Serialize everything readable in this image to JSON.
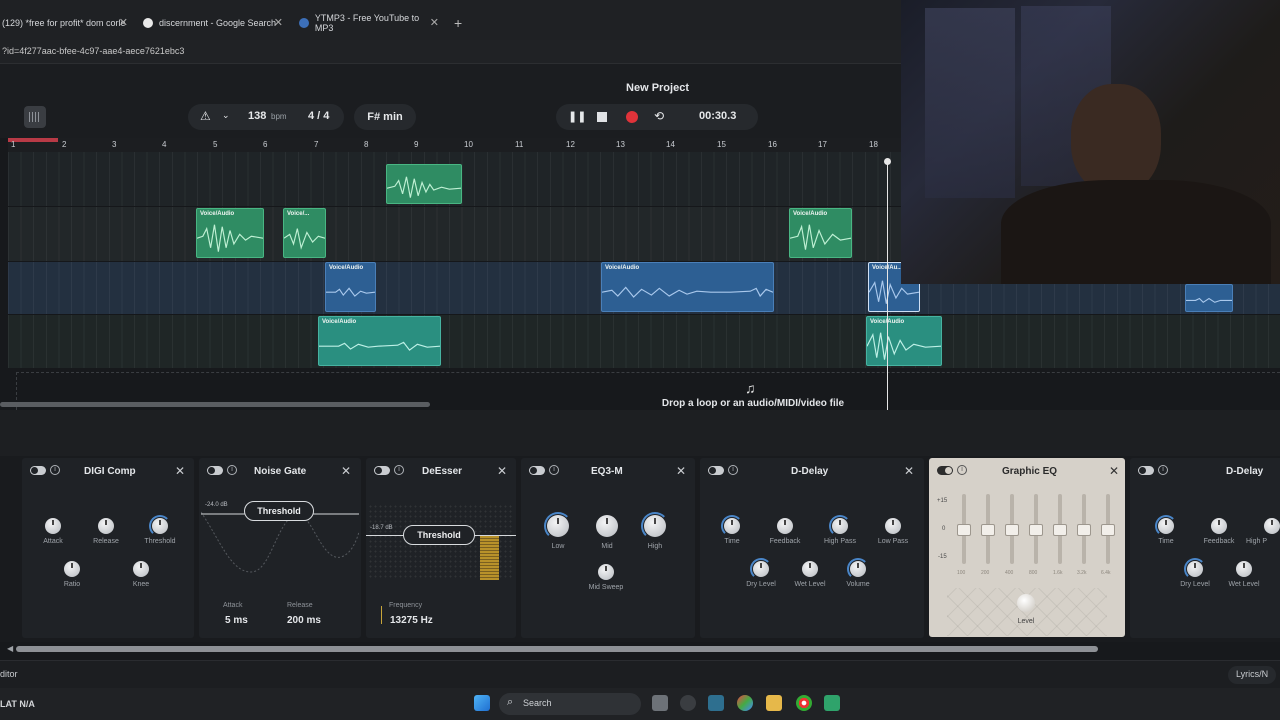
{
  "browser": {
    "tabs": [
      {
        "label": "(129) *free for profit* dom corle",
        "fav": "youtube-icon"
      },
      {
        "label": "discernment - Google Search",
        "fav": "google-icon"
      },
      {
        "label": "YTMP3 - Free YouTube to MP3",
        "fav": "globe-icon"
      }
    ],
    "new_tab": "+",
    "close": "✕",
    "url": "?id=4f277aac-bfee-4c97-aae4-aece7621ebc3"
  },
  "transport": {
    "project_title": "New Project",
    "bpm_value": "138",
    "bpm_unit": "bpm",
    "time_signature": "4 / 4",
    "key": "F# min",
    "time": "00:30.3"
  },
  "ruler": [
    "1",
    "2",
    "3",
    "4",
    "5",
    "6",
    "7",
    "8",
    "9",
    "10",
    "11",
    "12",
    "13",
    "14",
    "15",
    "16",
    "17",
    "18"
  ],
  "clips": {
    "label": "Voice/Audio",
    "label_short": "Voice/...",
    "label_mid": "Voice/Au..."
  },
  "dropzone": {
    "text": "Drop a loop or an audio/MIDI/video file",
    "icon": "music-add-icon"
  },
  "devices": {
    "digi_comp": {
      "name": "DIGI Comp",
      "knobs": [
        "Attack",
        "Release",
        "Threshold",
        "Ratio",
        "Knee"
      ]
    },
    "noise_gate": {
      "name": "Noise Gate",
      "db": "-24.0 dB",
      "threshold": "Threshold",
      "attack_label": "Attack",
      "attack_value": "5 ms",
      "release_label": "Release",
      "release_value": "200 ms"
    },
    "deesser": {
      "name": "DeEsser",
      "db": "-18.7 dB",
      "threshold": "Threshold",
      "freq_label": "Frequency",
      "freq_value": "13275 Hz"
    },
    "eq3": {
      "name": "EQ3-M",
      "knobs": [
        "Low",
        "Mid",
        "High",
        "Mid Sweep"
      ]
    },
    "ddelay": {
      "name": "D-Delay",
      "knobs": [
        "Time",
        "Feedback",
        "High Pass",
        "Low Pass",
        "Dry Level",
        "Wet Level",
        "Volume"
      ]
    },
    "graphic_eq": {
      "name": "Graphic EQ",
      "scale": [
        "+15",
        "0",
        "-15"
      ],
      "freqs": [
        "100",
        "200",
        "400",
        "800",
        "1.6k",
        "3.2k",
        "6.4k"
      ],
      "level": "Level"
    },
    "ddelay2": {
      "name": "D-Delay",
      "knobs": [
        "Time",
        "Feedback",
        "High P",
        "Dry Level",
        "Wet Level"
      ]
    }
  },
  "footer": {
    "left": "ditor",
    "right": "Lyrics/N"
  },
  "taskbar": {
    "weather": "LAT  N/A",
    "search": "Search"
  },
  "colors": {
    "green_clip": "#2f8c63",
    "blue_clip": "#2d5f93",
    "record": "#e0333a",
    "playhead": "#e6e6e6"
  }
}
